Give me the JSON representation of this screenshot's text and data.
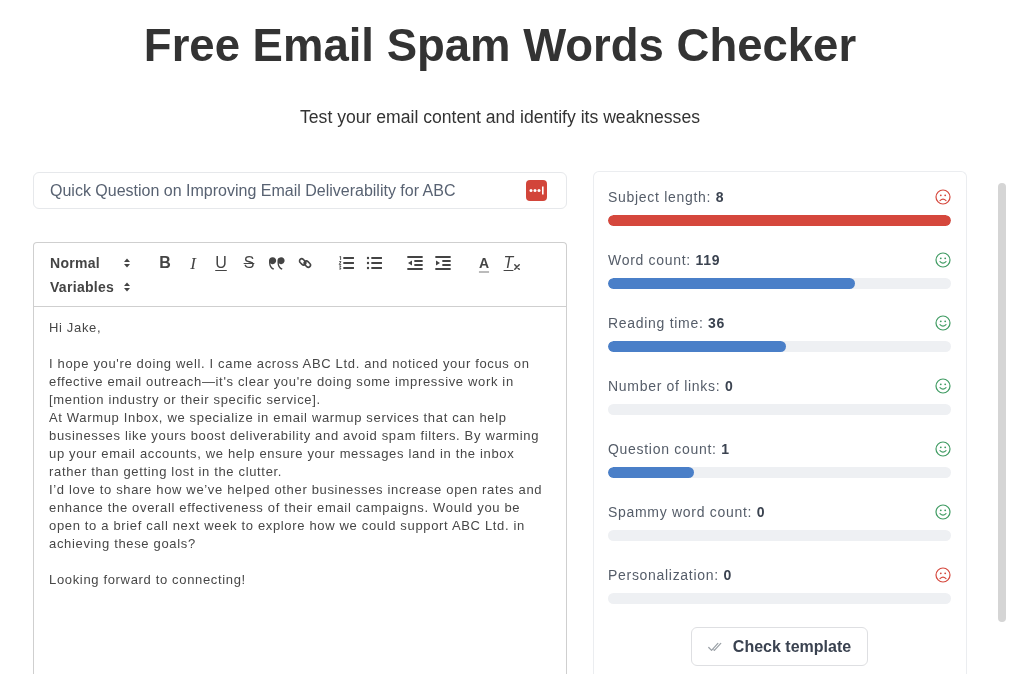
{
  "header": {
    "title": "Free Email Spam Words Checker",
    "subtitle": "Test your email content and identify its weaknesses"
  },
  "subject": {
    "value": "Quick Question on Improving Email Deliverability for ABC"
  },
  "editor": {
    "toolbar": {
      "format_select": "Normal",
      "groups": [
        [
          {
            "kind": "bold",
            "label": "B"
          },
          {
            "kind": "italic",
            "label": "I"
          },
          {
            "kind": "underline",
            "label": "U"
          },
          {
            "kind": "strike",
            "label": "S"
          },
          {
            "kind": "quote"
          },
          {
            "kind": "link"
          }
        ],
        [
          {
            "kind": "ordered-list"
          },
          {
            "kind": "bullet-list"
          }
        ],
        [
          {
            "kind": "outdent"
          },
          {
            "kind": "indent"
          }
        ],
        [
          {
            "kind": "color",
            "label": "A"
          },
          {
            "kind": "clean",
            "label": "T"
          }
        ]
      ],
      "variables_select": "Variables"
    },
    "body": [
      [
        "Hi Jake,"
      ],
      [
        "I hope you're doing well. I came across ABC Ltd. and noticed your focus on effective email outreach—it's clear you're doing some impressive work in [mention industry or their specific service].",
        "At Warmup Inbox, we specialize in email warmup services that can help businesses like yours boost deliverability and avoid spam filters. By warming up your email accounts, we help ensure your messages land in the inbox rather than getting lost in the clutter.",
        "I’d love to share how we’ve helped other businesses increase open rates and enhance the overall effectiveness of their email campaigns. Would you be open to a brief call next week to explore how we could support ABC Ltd. in achieving these goals?"
      ],
      [
        "Looking forward to connecting!"
      ]
    ]
  },
  "metrics": [
    {
      "text": "Subject length: **8**",
      "passed": false,
      "level": 1.0
    },
    {
      "text": "Word count: **119**",
      "passed": true,
      "level": 0.72
    },
    {
      "text": "Reading time: **36**",
      "passed": true,
      "level": 0.52
    },
    {
      "text": "Number of links: **0**",
      "passed": true,
      "level": 0
    },
    {
      "text": "Question count: **1**",
      "passed": true,
      "level": 0.25
    },
    {
      "text": "Spammy word count: **0**",
      "passed": true,
      "level": 0
    },
    {
      "text": "Personalization: **0**",
      "passed": false,
      "level": 0
    }
  ],
  "check_button": {
    "label": "Check template"
  }
}
